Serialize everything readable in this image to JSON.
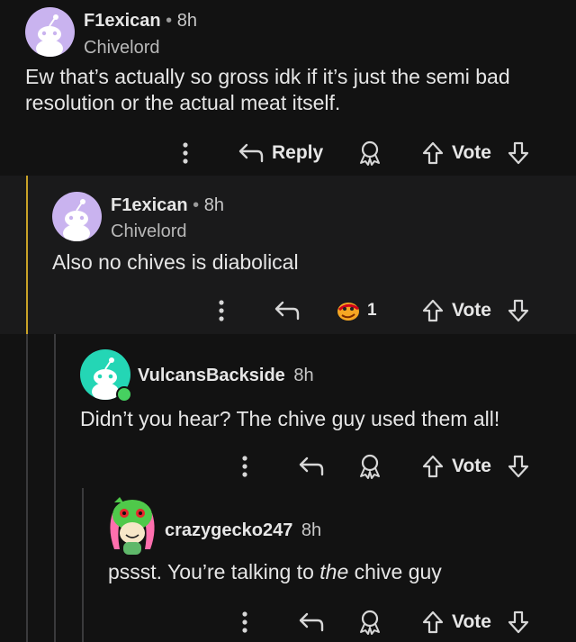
{
  "comments": [
    {
      "username": "F1exican",
      "time": "8h",
      "flair": "Chivelord",
      "body_lines": [
        "Ew that’s actually so gross idk if it’s just the semi bad",
        "resolution or the actual meat itself."
      ],
      "reply_label": "Reply",
      "vote_label": "Vote"
    },
    {
      "username": "F1exican",
      "time": "8h",
      "flair": "Chivelord",
      "body": "Also no chives is diabolical",
      "award_count": "1",
      "vote_label": "Vote"
    },
    {
      "username": "VulcansBackside",
      "time": "8h",
      "body": "Didn’t you hear? The chive guy used them all!",
      "vote_label": "Vote"
    },
    {
      "username": "crazygecko247",
      "time": "8h",
      "body_prefix": "pssst. You’re talking to ",
      "body_emphasis": "the",
      "body_suffix": " chive guy",
      "vote_label": "Vote"
    }
  ],
  "colors": {
    "background": "#121212",
    "highlight_background": "#1a1a1b",
    "thread_line_active": "#c9a227",
    "online_indicator": "#46d160"
  }
}
